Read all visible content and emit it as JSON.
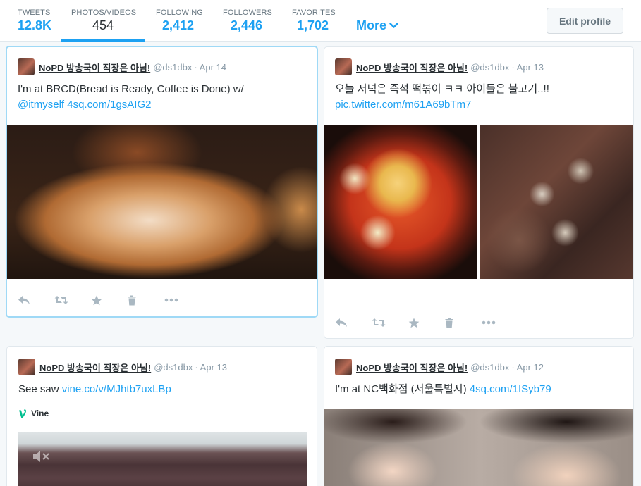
{
  "nav": {
    "stats": [
      {
        "label": "TWEETS",
        "value": "12.8K"
      },
      {
        "label": "PHOTOS/VIDEOS",
        "value": "454"
      },
      {
        "label": "FOLLOWING",
        "value": "2,412"
      },
      {
        "label": "FOLLOWERS",
        "value": "2,446"
      },
      {
        "label": "FAVORITES",
        "value": "1,702"
      }
    ],
    "more_label": "More",
    "edit_profile_label": "Edit profile"
  },
  "tweets": [
    {
      "username": "NoPD 방송국이 직장은 아님!",
      "handle": "@ds1dbx",
      "date": "Apr 14",
      "text": "I'm at BRCD(Bread is Ready, Coffee is Done) w/",
      "link1": "@itmyself",
      "link2": "4sq.com/1gsAIG2"
    },
    {
      "username": "NoPD 방송국이 직장은 아님!",
      "handle": "@ds1dbx",
      "date": "Apr 13",
      "text": "오늘 저녁은 즉석 떡볶이 ㅋㅋ 아이들은 불고기..!!",
      "link1": "pic.twitter.com/m61A69bTm7"
    },
    {
      "username": "NoPD 방송국이 직장은 아님!",
      "handle": "@ds1dbx",
      "date": "Apr 13",
      "text": "See saw",
      "link1": "vine.co/v/MJhtb7uxLBp",
      "vine_label": "Vine"
    },
    {
      "username": "NoPD 방송국이 직장은 아님!",
      "handle": "@ds1dbx",
      "date": "Apr 12",
      "text": "I'm at NC백화점 (서울특별시)",
      "link1": "4sq.com/1ISyb79"
    }
  ],
  "icons": [
    "reply-icon",
    "retweet-icon",
    "favorite-icon",
    "delete-icon",
    "more-icon",
    "vine-icon",
    "mute-icon",
    "chevron-down-icon"
  ],
  "colors": {
    "accent": "#1da1f2",
    "text": "#292f33",
    "muted": "#8899a6",
    "focus_border": "#9fd9f6",
    "background": "#f5f8fa"
  }
}
